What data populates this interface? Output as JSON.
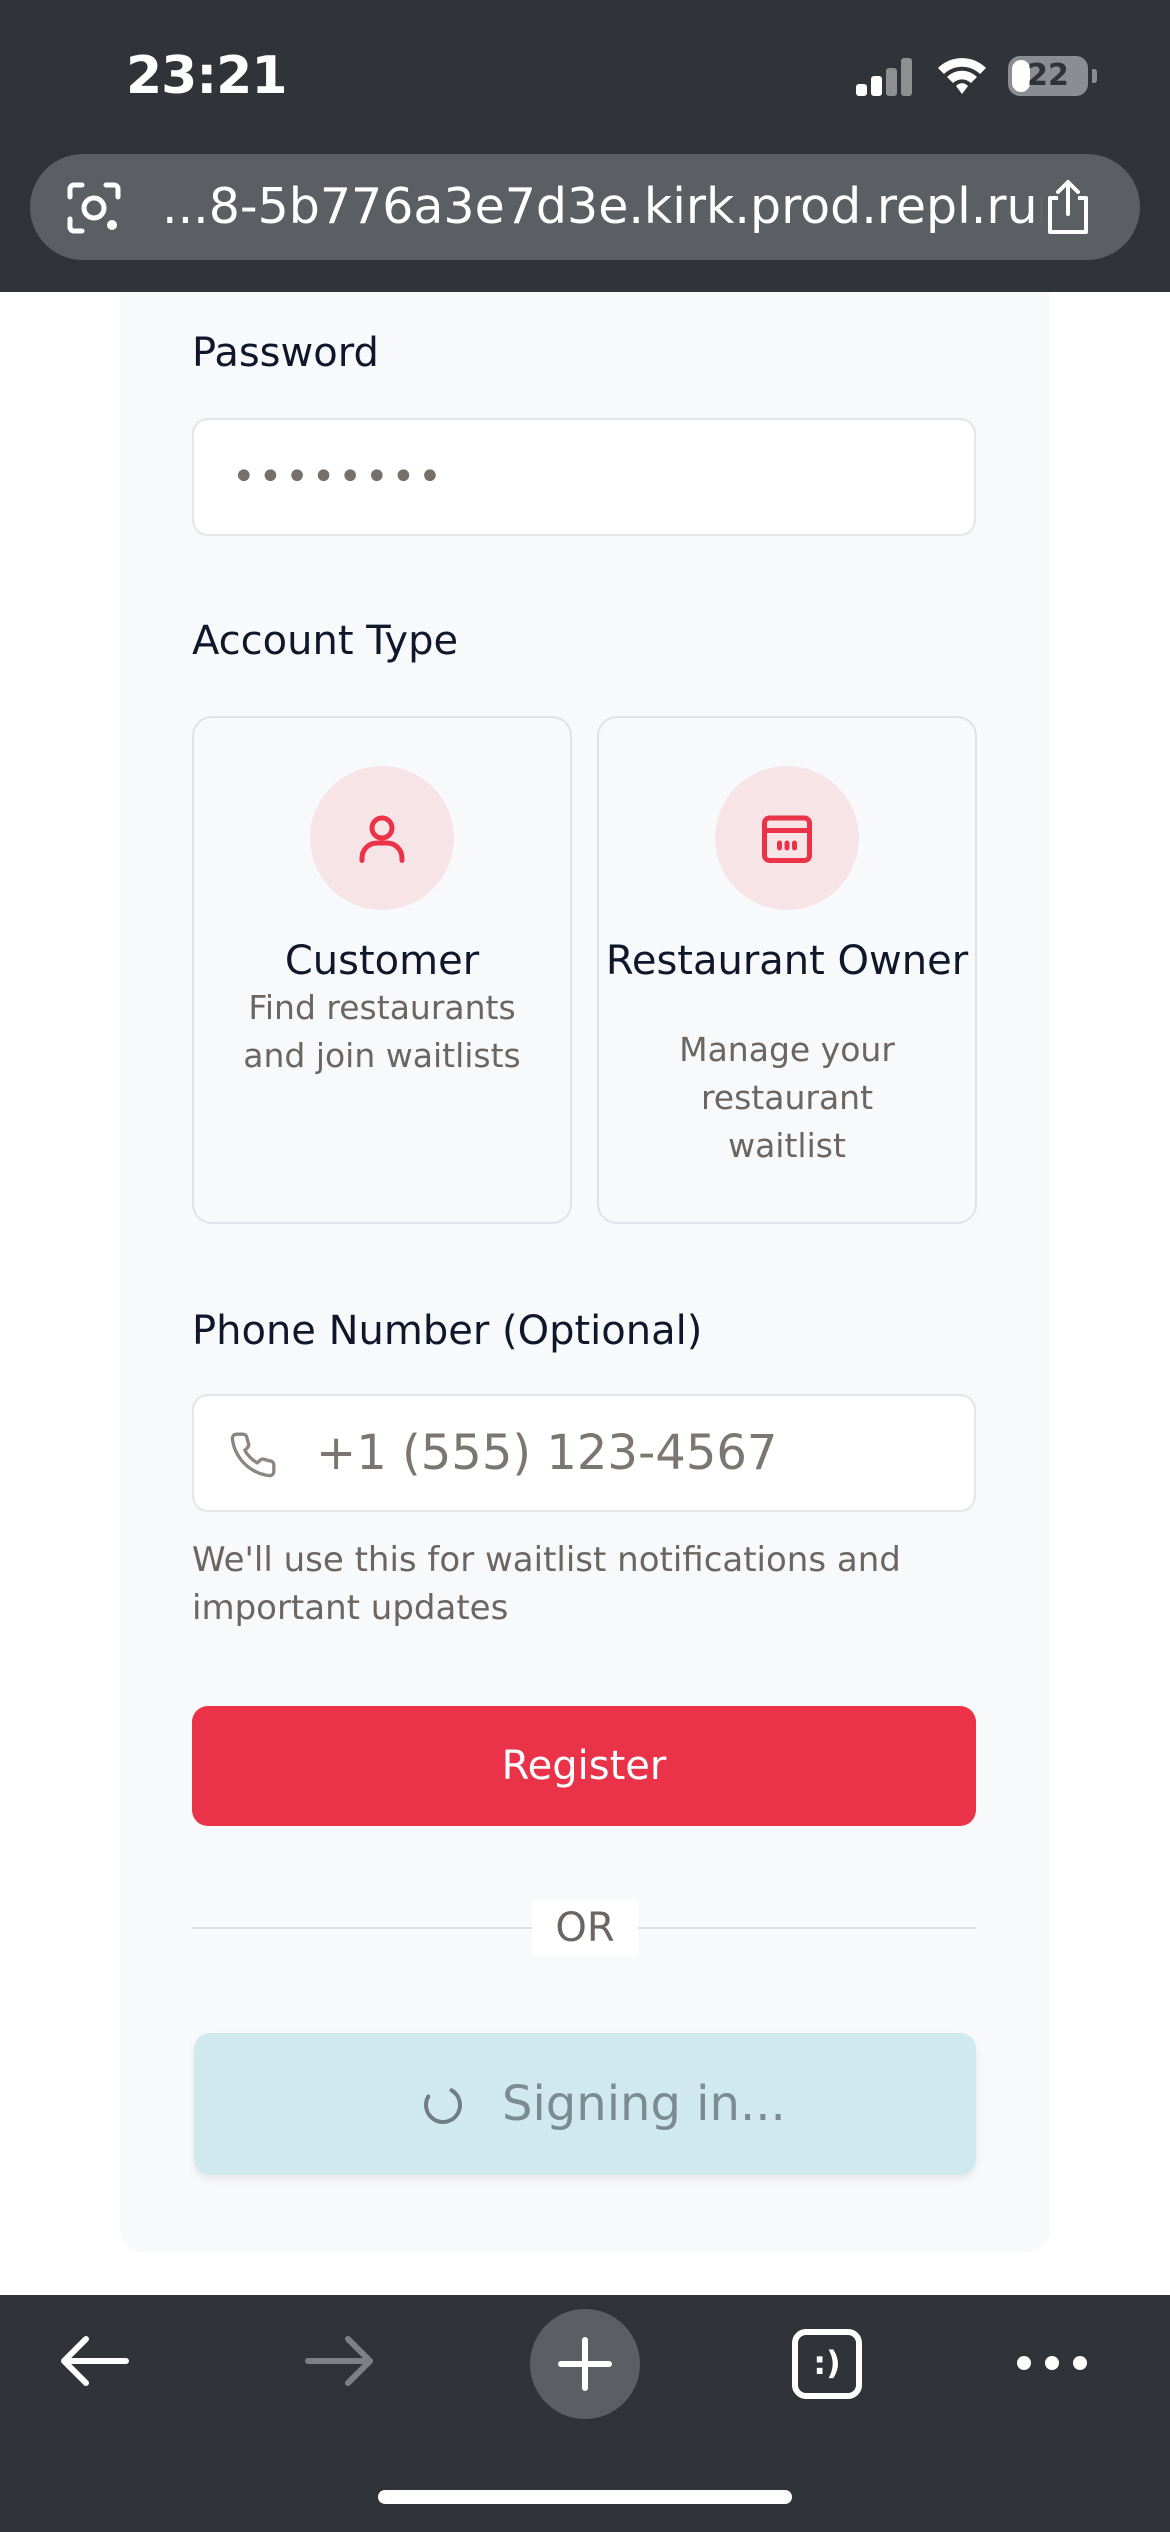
{
  "status_bar": {
    "time": "23:21",
    "battery_percent": "22",
    "battery_level": 0.22,
    "signal_bars": 2,
    "icons": [
      "signal-icon",
      "wifi-icon",
      "battery-icon"
    ]
  },
  "browser": {
    "url": "...8-5b776a3e7d3e.kirk.prod.repl.run",
    "icons": [
      "lens-icon",
      "share-icon"
    ],
    "toolbar_icons": [
      "back-arrow-icon",
      "forward-arrow-icon",
      "new-tab-plus-icon",
      "tabs-icon",
      "more-dots-icon"
    ],
    "tabs_glyph": ":)"
  },
  "form": {
    "password_label": "Password",
    "password_value": "••••••••",
    "account_type_label": "Account Type",
    "account_types": [
      {
        "title": "Customer",
        "description": "Find restaurants and join waitlists",
        "icon": "user-icon"
      },
      {
        "title": "Restaurant Owner",
        "description": "Manage your restaurant waitlist",
        "icon": "calendar-icon"
      }
    ],
    "phone_label": "Phone Number (Optional)",
    "phone_placeholder": "+1 (555) 123-4567",
    "phone_hint": "We'll use this for waitlist notifications and important updates",
    "register_label": "Register",
    "or_label": "OR",
    "signin_label": "Signing in..."
  },
  "colors": {
    "accent": "#ea3348",
    "icon_bg": "#f7e4e6",
    "signin_bg": "#d0e9ee",
    "chrome_bg": "#303337"
  }
}
